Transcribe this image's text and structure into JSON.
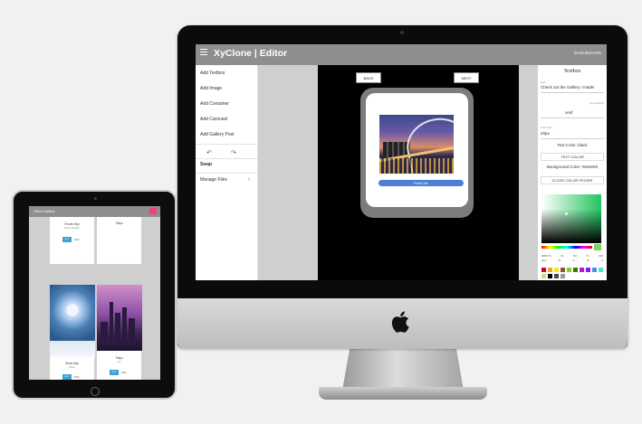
{
  "editor": {
    "title": "XyClone | Editor",
    "dashboard_link": "DASHBOARD",
    "side_menu": {
      "items": [
        "Add Textbox",
        "Add Image",
        "Add Container",
        "Add Carousel",
        "Add Gallery Post"
      ],
      "undo_icon": "undo-icon",
      "redo_icon": "redo-icon",
      "swap_label": "Swap",
      "manage_files_label": "Manage Files",
      "chevron": "›"
    },
    "stage": {
      "back_label": "BACK",
      "next_label": "NEXT",
      "push_button_label": "Push Me"
    },
    "properties": {
      "panel_title": "Textbox",
      "text_label": "Text",
      "text_value": "Check out the Gallery I made!",
      "font_family_label": "Font Family",
      "font_family_value": "serif",
      "font_size_label": "Font Size",
      "font_size_value": "20px",
      "text_color_label": "Text Color: black",
      "text_color_button": "TEXT COLOR",
      "background_color_label": "Background Color: #0e0e0d",
      "close_picker_button": "CLOSE COLOR PICKER",
      "rgb_values": [
        "66BC71",
        "01",
        "B4",
        "71",
        "100"
      ],
      "rgb_labels": [
        "Hex",
        "R",
        "G",
        "B",
        "A"
      ],
      "swatch_colors": [
        "#d0021b",
        "#f5a623",
        "#f8e71c",
        "#8b572a",
        "#7ed321",
        "#417505",
        "#bd10e0",
        "#9013fe",
        "#4a90e2",
        "#50e3c2",
        "#b8e986",
        "#000000",
        "#4a4a4a",
        "#9b9b9b",
        "#ffffff"
      ]
    }
  },
  "tablet": {
    "title": "XDex Gallery",
    "cards": [
      {
        "title": "Frozen Sky",
        "subtitle": "Cloudy Weather",
        "button": "BUY",
        "price": "$199"
      },
      {
        "title": "Tokyo",
        "subtitle": "",
        "button": "",
        "price": ""
      },
      {
        "title": "Snow Day",
        "subtitle": "Winter",
        "button": "BUY",
        "price": "$199"
      },
      {
        "title": "Tokyo",
        "subtitle": "City",
        "button": "BUY",
        "price": "$199"
      }
    ]
  }
}
